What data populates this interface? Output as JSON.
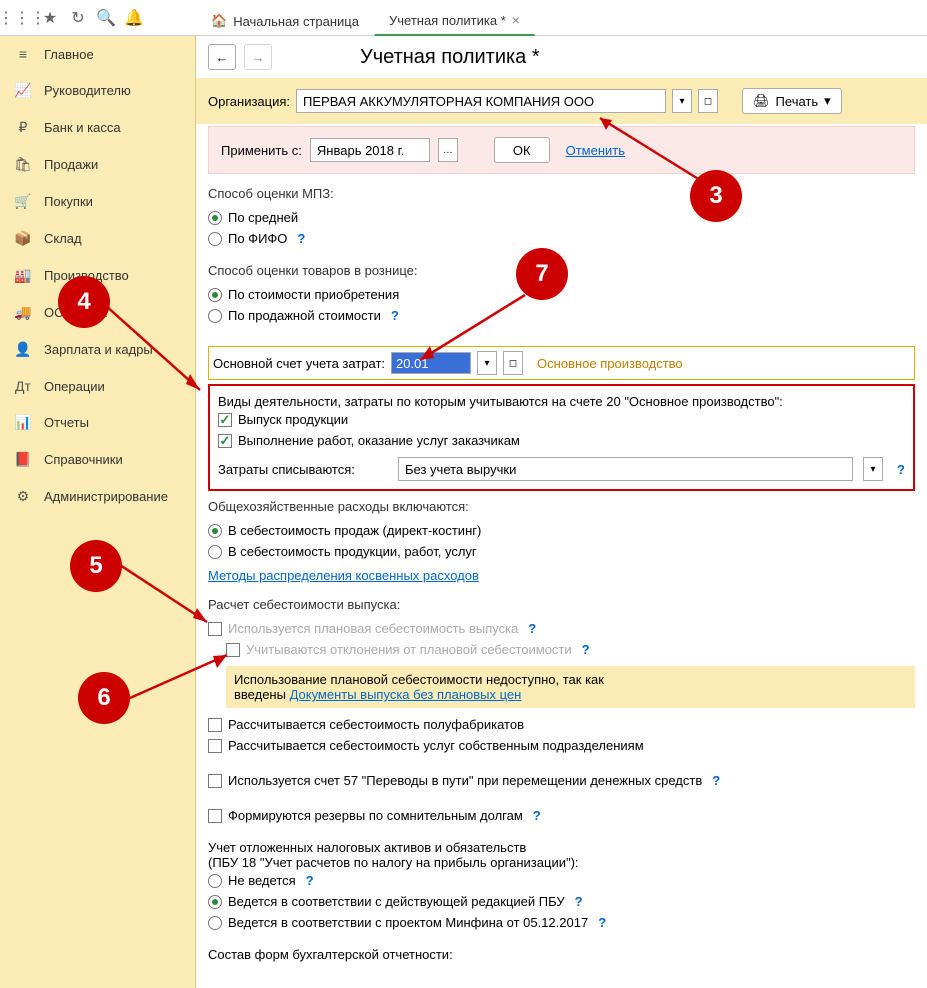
{
  "tabs": {
    "home": "Начальная страница",
    "active": "Учетная политика *"
  },
  "sidebar": {
    "items": [
      {
        "icon": "≡",
        "label": "Главное"
      },
      {
        "icon": "📈",
        "label": "Руководителю"
      },
      {
        "icon": "₽",
        "label": "Банк и касса"
      },
      {
        "icon": "🛍",
        "label": "Продажи"
      },
      {
        "icon": "🛒",
        "label": "Покупки"
      },
      {
        "icon": "📦",
        "label": "Склад"
      },
      {
        "icon": "🏭",
        "label": "Производство"
      },
      {
        "icon": "🚚",
        "label": "ОС и НМА"
      },
      {
        "icon": "👤",
        "label": "Зарплата и кадры"
      },
      {
        "icon": "Дт",
        "label": "Операции"
      },
      {
        "icon": "📊",
        "label": "Отчеты"
      },
      {
        "icon": "📕",
        "label": "Справочники"
      },
      {
        "icon": "⚙",
        "label": "Администрирование"
      }
    ]
  },
  "page": {
    "title": "Учетная политика *"
  },
  "org": {
    "label": "Организация:",
    "value": "ПЕРВАЯ АККУМУЛЯТОРНАЯ КОМПАНИЯ ООО"
  },
  "print": "Печать",
  "apply": {
    "label": "Применить с:",
    "date": "Январь 2018 г.",
    "ok": "ОК",
    "cancel": "Отменить"
  },
  "mpz": {
    "label": "Способ оценки МПЗ:",
    "opt1": "По средней",
    "opt2": "По ФИФО"
  },
  "retail": {
    "label": "Способ оценки товаров в рознице:",
    "opt1": "По стоимости приобретения",
    "opt2": "По продажной стоимости"
  },
  "account": {
    "label": "Основной счет учета затрат:",
    "value": "20.01",
    "desc": "Основное производство"
  },
  "activities": {
    "label": "Виды деятельности, затраты по которым учитываются на счете 20 \"Основное производство\":",
    "opt1": "Выпуск продукции",
    "opt2": "Выполнение работ, оказание услуг заказчикам",
    "writeoff_label": "Затраты списываются:",
    "writeoff_value": "Без учета выручки"
  },
  "overhead": {
    "label": "Общехозяйственные расходы включаются:",
    "opt1": "В себестоимость продаж (директ-костинг)",
    "opt2": "В  себестоимость продукции, работ, услуг",
    "link": "Методы распределения косвенных расходов"
  },
  "cost": {
    "label": "Расчет себестоимости выпуска:",
    "plan": "Используется плановая себестоимость выпуска",
    "dev": "Учитываются отклонения от плановой себестоимости",
    "warn1": "Использование плановой себестоимости недоступно, так как",
    "warn2": "введены ",
    "warn_link": "Документы выпуска без плановых цен",
    "semi": "Рассчитывается себестоимость полуфабрикатов",
    "own": "Рассчитывается себестоимость услуг собственным подразделениям"
  },
  "acc57": "Используется счет 57 \"Переводы в пути\" при перемещении денежных средств",
  "reserves": "Формируются резервы по сомнительным долгам",
  "deferred": {
    "label1": "Учет отложенных налоговых активов и обязательств",
    "label2": "(ПБУ 18 \"Учет расчетов по налогу на прибыль организации\"):",
    "opt1": "Не ведется",
    "opt2": "Ведется в соответствии с действующей редакцией ПБУ",
    "opt3": "Ведется в соответствии с проектом Минфина от 05.12.2017"
  },
  "forms": "Состав форм бухгалтерской отчетности:",
  "callouts": {
    "c3": "3",
    "c4": "4",
    "c5": "5",
    "c6": "6",
    "c7": "7"
  }
}
